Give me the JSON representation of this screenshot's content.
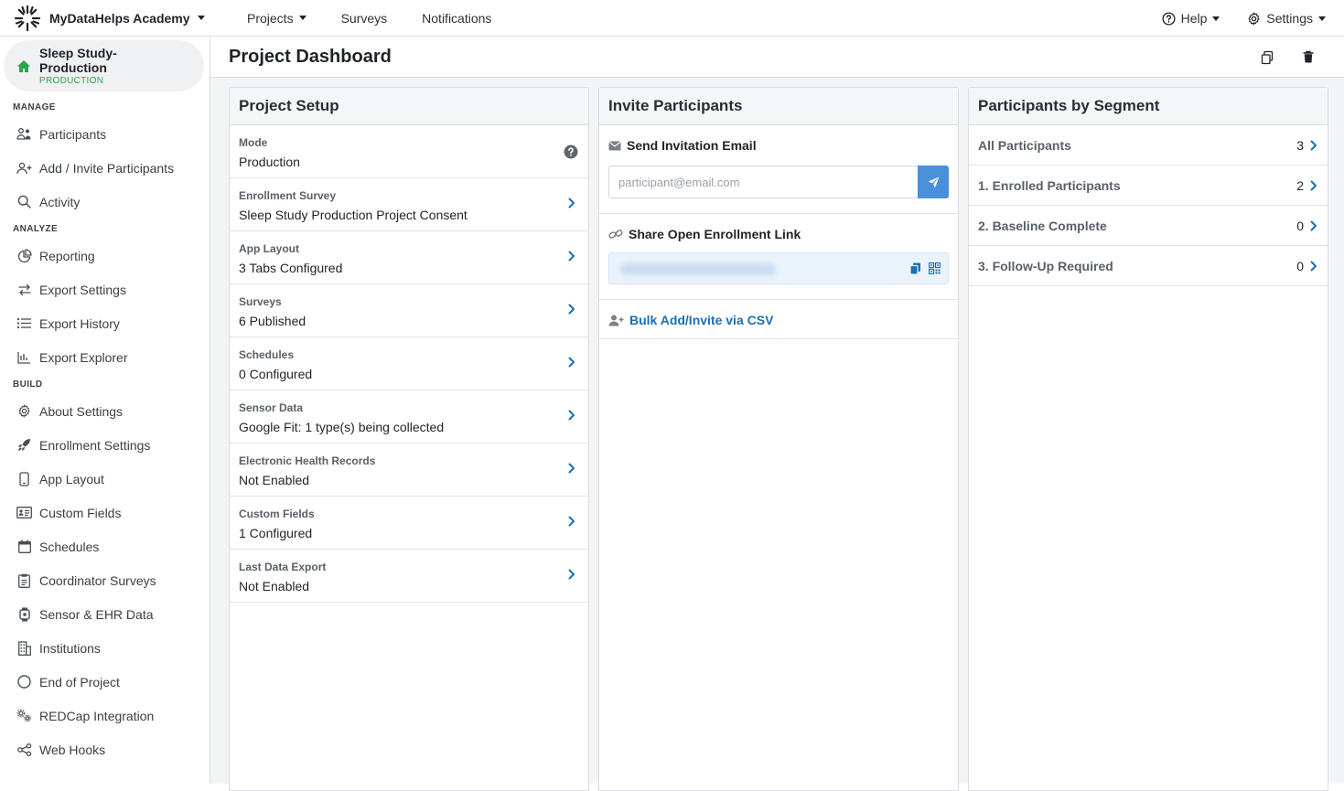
{
  "app": {
    "brand": "MyDataHelps Academy",
    "nav": [
      "Projects",
      "Surveys",
      "Notifications"
    ],
    "help": "Help",
    "settings": "Settings"
  },
  "sidebar": {
    "project_name": "Sleep Study-Production",
    "project_env": "PRODUCTION",
    "sections": {
      "manage": "MANAGE",
      "analyze": "ANALYZE",
      "build": "BUILD"
    },
    "manage_items": [
      {
        "label": "Participants",
        "icon": "participants-icon"
      },
      {
        "label": "Add / Invite Participants",
        "icon": "add-user-icon"
      },
      {
        "label": "Activity",
        "icon": "search-icon"
      }
    ],
    "analyze_items": [
      {
        "label": "Reporting",
        "icon": "pie-chart-icon"
      },
      {
        "label": "Export Settings",
        "icon": "arrows-exchange-icon"
      },
      {
        "label": "Export History",
        "icon": "list-icon"
      },
      {
        "label": "Export Explorer",
        "icon": "bar-chart-icon"
      }
    ],
    "build_items": [
      {
        "label": "About Settings",
        "icon": "gear-icon"
      },
      {
        "label": "Enrollment Settings",
        "icon": "rocket-icon"
      },
      {
        "label": "App Layout",
        "icon": "phone-icon"
      },
      {
        "label": "Custom Fields",
        "icon": "id-card-icon"
      },
      {
        "label": "Schedules",
        "icon": "calendar-icon"
      },
      {
        "label": "Coordinator Surveys",
        "icon": "clipboard-icon"
      },
      {
        "label": "Sensor & EHR Data",
        "icon": "watch-icon"
      },
      {
        "label": "Institutions",
        "icon": "building-icon"
      },
      {
        "label": "End of Project",
        "icon": "circle-icon"
      },
      {
        "label": "REDCap Integration",
        "icon": "gears-icon"
      },
      {
        "label": "Web Hooks",
        "icon": "share-nodes-icon"
      }
    ]
  },
  "page": {
    "title": "Project Dashboard"
  },
  "setup": {
    "title": "Project Setup",
    "rows": [
      {
        "label": "Mode",
        "value": "Production"
      },
      {
        "label": "Enrollment Survey",
        "value": "Sleep Study Production Project Consent"
      },
      {
        "label": "App Layout",
        "value": "3 Tabs Configured"
      },
      {
        "label": "Surveys",
        "value": "6 Published"
      },
      {
        "label": "Schedules",
        "value": "0 Configured"
      },
      {
        "label": "Sensor Data",
        "value": "Google Fit: 1 type(s) being collected"
      },
      {
        "label": "Electronic Health Records",
        "value": "Not Enabled"
      },
      {
        "label": "Custom Fields",
        "value": "1 Configured"
      },
      {
        "label": "Last Data Export",
        "value": "Not Enabled"
      }
    ]
  },
  "invite": {
    "title": "Invite Participants",
    "send_email_title": "Send Invitation Email",
    "email_placeholder": "participant@email.com",
    "share_link_title": "Share Open Enrollment Link",
    "bulk_link": "Bulk Add/Invite via CSV"
  },
  "segments": {
    "title": "Participants by Segment",
    "rows": [
      {
        "label": "All Participants",
        "count": "3"
      },
      {
        "label": "1. Enrolled Participants",
        "count": "2"
      },
      {
        "label": "2. Baseline Complete",
        "count": "0"
      },
      {
        "label": "3. Follow-Up Required",
        "count": "0"
      }
    ]
  },
  "colors": {
    "accent": "#1b6fb3",
    "send_button": "#4a90d9",
    "production_green": "#2ea44f"
  }
}
